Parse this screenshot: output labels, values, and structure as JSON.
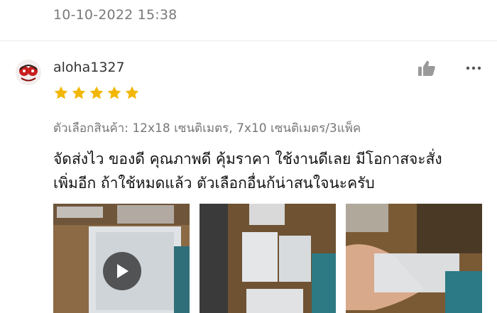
{
  "previous_review": {
    "date": "10-10-2022 15:38"
  },
  "review": {
    "username": "aloha1327",
    "rating": 5,
    "rating_max": 5,
    "variant": "ตัวเลือกสินค้า: 12x18 เซนติเมตร, 7x10 เซนติเมตร/3แพ็ค",
    "text_lines": [
      "จัดส่งไว ของดี คุณภาพดี คุ้มราคา ใช้งานดีเลย มีโอกาสจะสั่ง",
      "เพิ่มอีก ถ้าใช้หมดแล้ว ตัวเลือกอื่นก้น่าสนใจนะครับ"
    ],
    "media": [
      {
        "type": "video",
        "icon": "play-icon"
      },
      {
        "type": "photo"
      },
      {
        "type": "photo"
      }
    ]
  },
  "icons": {
    "like": "thumbs-up-icon",
    "more": "more-dots-icon",
    "star": "star-icon"
  },
  "colors": {
    "star": "#f2b705",
    "icon_gray": "#9a9a9a",
    "muted_text": "#7a7a7a"
  }
}
